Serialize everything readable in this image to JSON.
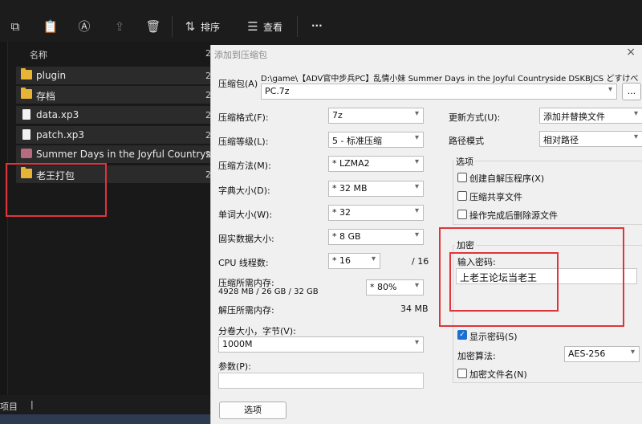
{
  "explorer": {
    "toolbar": {
      "sort_label": "排序",
      "view_label": "查看",
      "more_label": "···"
    },
    "column_name": "名称",
    "items": [
      {
        "name": "plugin",
        "type": "folder"
      },
      {
        "name": "存档",
        "type": "folder"
      },
      {
        "name": "data.xp3",
        "type": "file"
      },
      {
        "name": "patch.xp3",
        "type": "file"
      },
      {
        "name": "Summer Days in the Joyful Countrysi...",
        "type": "app"
      },
      {
        "name": "老王打包",
        "type": "folder"
      }
    ],
    "date_prefix": "2",
    "status_text": "项目",
    "status_sep": "|"
  },
  "dialog": {
    "title": "添加到压缩包",
    "close_glyph": "×",
    "archive_label": "压缩包(A)",
    "archive_path_line1": "D:\\game\\【ADV官中步兵PC】乱情小妹 Summer Days in the Joyful Countryside DSKBJCS どすけべじゅ～",
    "archive_path_line2": "PC.7z",
    "browse_label": "...",
    "left": {
      "format_label": "压缩格式(F):",
      "format_value": "7z",
      "level_label": "压缩等级(L):",
      "level_value": "5 - 标准压缩",
      "method_label": "压缩方法(M):",
      "method_value": "* LZMA2",
      "dict_label": "字典大小(D):",
      "dict_value": "* 32 MB",
      "word_label": "单词大小(W):",
      "word_value": "* 32",
      "solid_label": "固实数据大小:",
      "solid_value": "* 8 GB",
      "threads_label": "CPU 线程数:",
      "threads_value": "* 16",
      "threads_max": "/ 16",
      "mem_label": "压缩所需内存:",
      "mem_value": "4928 MB / 26 GB / 32 GB",
      "mem_pct": "* 80%",
      "decomp_label": "解压所需内存:",
      "decomp_value": "34 MB",
      "split_label": "分卷大小，字节(V):",
      "split_value": "1000M",
      "params_label": "参数(P):",
      "options_button": "选项"
    },
    "right": {
      "update_label": "更新方式(U):",
      "update_value": "添加并替换文件",
      "path_label": "路径模式",
      "path_value": "相对路径",
      "options_group": "选项",
      "opt_sfx": "创建自解压程序(X)",
      "opt_shared": "压缩共享文件",
      "opt_delete": "操作完成后删除源文件",
      "encrypt_group": "加密",
      "password_label": "输入密码:",
      "password_value": "上老王论坛当老王",
      "show_password": "显示密码(S)",
      "algo_label": "加密算法:",
      "algo_value": "AES-256",
      "encrypt_names": "加密文件名(N)",
      "check_glyph": "✓"
    }
  },
  "colors": {
    "highlight": "#e0343b",
    "folder": "#e7b436",
    "checkbox_on": "#1a6fd1"
  }
}
